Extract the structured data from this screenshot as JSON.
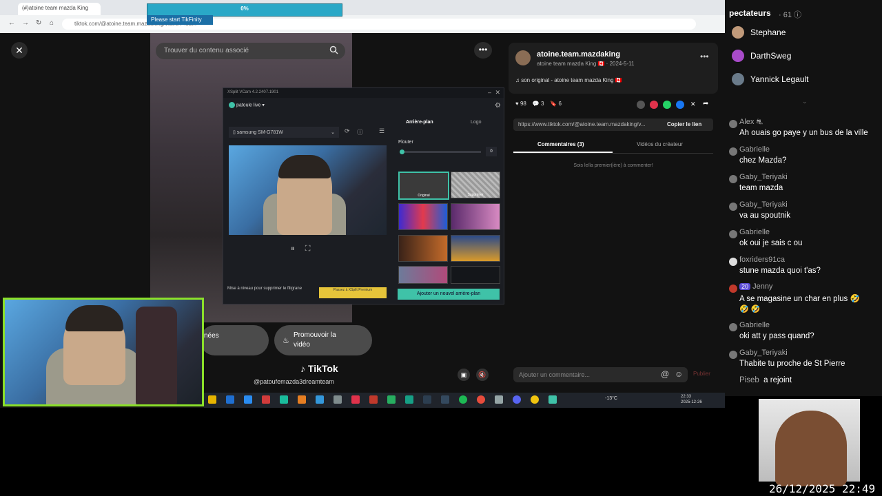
{
  "browser": {
    "tab_title": "(#)atoine team mazda King",
    "address": "tiktok.com/@atoine.team.mazdaking/video/7452...",
    "nav": {
      "back": "←",
      "forward": "→",
      "reload": "↻",
      "home": "⌂"
    }
  },
  "overlay": {
    "progress_label": "0%",
    "progress_value": 0,
    "tikfinity_label": "Please start TikFinity"
  },
  "tiktok": {
    "close_glyph": "✕",
    "search_placeholder": "Trouver du contenu associé",
    "more_glyph": "•••",
    "author": "atoine.team.mazdaking",
    "author_sub": "atoine team mazda King 🇨🇦 · 2024-5-11",
    "sound": "♫  son original - atoine team mazda King 🇨🇦",
    "likes": "98",
    "comments_count": "3",
    "saves": "6",
    "url": "https://www.tiktok.com/@atoine.team.mazdaking/v...",
    "copy_link": "Copier le lien",
    "tab_comments": "Commentaires (3)",
    "tab_videos": "Vidéos du créateur",
    "first_comment": "Sois le/la premier(ière) à commenter!",
    "add_comment_placeholder": "Ajouter un commentaire...",
    "publish": "Publier",
    "prev_pill": "nées",
    "promote_line1": "Promouvoir la",
    "promote_line2": "vidéo",
    "logo_text": "TikTok",
    "handle": "@patoufemazda3dreamteam"
  },
  "xsplit": {
    "title": "XSplit VCam 4.2.2407.1901",
    "user": "patoule live",
    "device": "samsung SM-G781W",
    "tab_background": "Arrière-plan",
    "tab_logo": "Logo",
    "blur_label": "Flouter",
    "blur_value": "0",
    "thumb_original": "Original",
    "thumb_remove": "Supprimer",
    "upgrade_text": "Mise à niveau pour supprimer le filigrane",
    "premium_button": "Passez à XSplit Premium",
    "add_background": "Ajouter un nouvel arrière-plan"
  },
  "taskbar": {
    "temperature": "-13°C",
    "time": "22:33",
    "date": "2025-12-26"
  },
  "chat": {
    "viewers_header": "pectateurs",
    "viewers_count": "· 61 ⓘ",
    "viewers": [
      "Stephane",
      "DarthSweg",
      "Yannick Legault"
    ],
    "messages": [
      {
        "user": "Alex",
        "badge": "⛐",
        "text": "Ah ouais go paye y un bus de la ville"
      },
      {
        "user": "Gabrielle",
        "badge": "",
        "text": "chez Mazda?"
      },
      {
        "user": "Gaby_Teriyaki",
        "badge": "",
        "text": "team mazda"
      },
      {
        "user": "Gaby_Teriyaki",
        "badge": "",
        "text": "va au spoutnik"
      },
      {
        "user": "Gabrielle",
        "badge": "",
        "text": "ok oui je sais c ou"
      },
      {
        "user": "foxriders91ca",
        "badge": "",
        "text": "stune mazda quoi t'as?"
      },
      {
        "user": "Jenny",
        "badge": "20",
        "text": "A se magasine un char en plus 🤣"
      },
      {
        "user": "Gabrielle",
        "badge": "",
        "text": "oki att y pass quand?"
      },
      {
        "user": "Gaby_Teriyaki",
        "badge": "",
        "text": "Thabite tu proche de St Pierre"
      }
    ],
    "extra_emoji": "🤣 🤣",
    "joined_user": "Piseb",
    "joined_text": "a rejoint"
  },
  "stream": {
    "timestamp": "26/12/2025 22:49"
  }
}
